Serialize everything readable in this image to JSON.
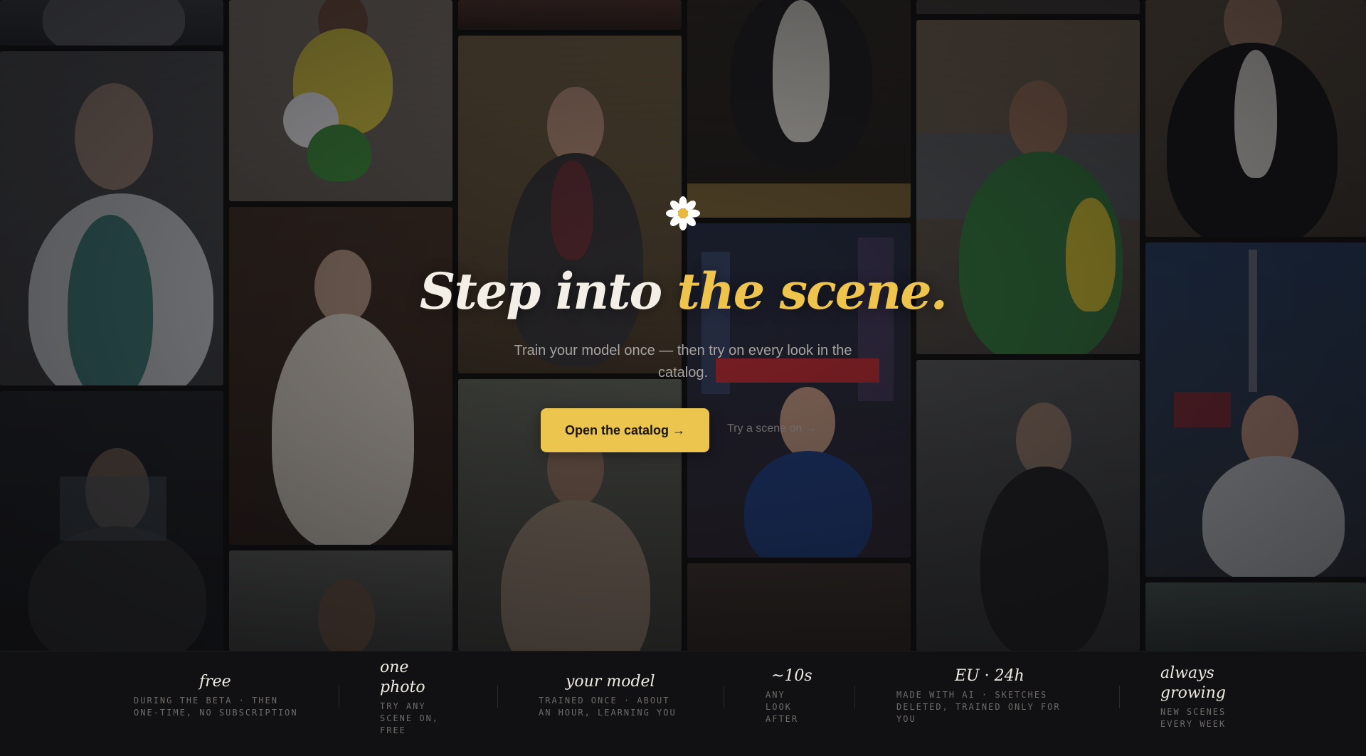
{
  "hero": {
    "headline_start": "Step into",
    "headline_accent": "the scene.",
    "subhead": "Train your model once — then try on every look in the catalog.",
    "cta_label": "Open the catalog →",
    "secondary_label": "Try a scene on →",
    "accent_color": "#ebc54e"
  },
  "stats": [
    {
      "title": "free",
      "desc": "DURING THE BETA · THEN ONE-TIME, NO SUBSCRIPTION"
    },
    {
      "title": "one photo",
      "desc": "TRY ANY SCENE ON, FREE"
    },
    {
      "title": "your model",
      "desc": "TRAINED ONCE · ABOUT AN HOUR, LEARNING YOU"
    },
    {
      "title": "~10s",
      "desc": "ANY LOOK AFTER"
    },
    {
      "title": "EU · 24h",
      "desc": "MADE WITH AI · SKETCHES DELETED, TRAINED ONLY FOR YOU"
    },
    {
      "title": "always growing",
      "desc": "NEW SCENES EVERY WEEK"
    }
  ],
  "mosaic_icons": [
    "daisy-icon"
  ]
}
